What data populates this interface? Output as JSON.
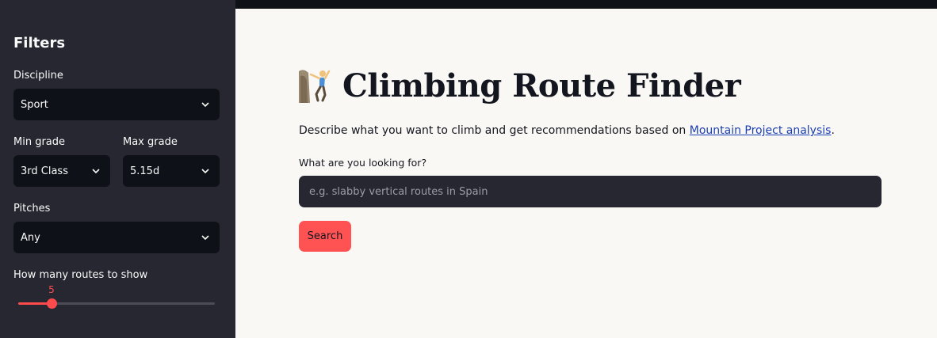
{
  "sidebar": {
    "title": "Filters",
    "discipline": {
      "label": "Discipline",
      "value": "Sport"
    },
    "min_grade": {
      "label": "Min grade",
      "value": "3rd Class"
    },
    "max_grade": {
      "label": "Max grade",
      "value": "5.15d"
    },
    "pitches": {
      "label": "Pitches",
      "value": "Any"
    },
    "routes_slider": {
      "label": "How many routes to show",
      "value": 5,
      "display": "5",
      "fraction": 0.17
    }
  },
  "main": {
    "title": "Climbing Route Finder",
    "description_prefix": "Describe what you want to climb and get recommendations based on ",
    "description_link": "Mountain Project analysis",
    "description_suffix": ".",
    "query_label": "What are you looking for?",
    "query_placeholder": "e.g. slabby vertical routes in Spain",
    "search_button": "Search"
  },
  "colors": {
    "accent": "#ff4b4b",
    "sidebar_bg": "#262730",
    "link": "#1c3fb3"
  }
}
